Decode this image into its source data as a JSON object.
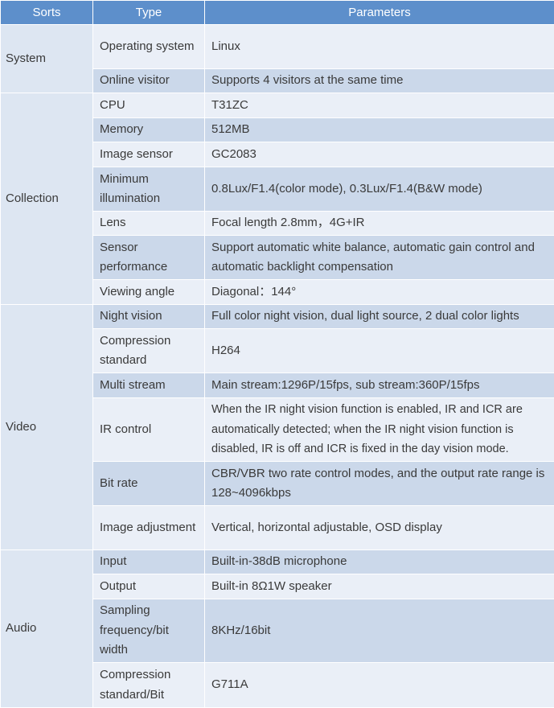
{
  "header": {
    "sorts": "Sorts",
    "type": "Type",
    "parameters": "Parameters"
  },
  "groups": [
    {
      "sort": "System",
      "rows": [
        {
          "type": "Operating system",
          "value": "Linux"
        },
        {
          "type": "Online visitor",
          "value": "Supports 4 visitors at the same time"
        }
      ]
    },
    {
      "sort": "Collection",
      "rows": [
        {
          "type": "CPU",
          "value": "T31ZC"
        },
        {
          "type": "Memory",
          "value": "512MB"
        },
        {
          "type": "Image sensor",
          "value": "GC2083"
        },
        {
          "type": "Minimum illumination",
          "value": "0.8Lux/F1.4(color mode), 0.3Lux/F1.4(B&W mode)"
        },
        {
          "type": "Lens",
          "value": "Focal length 2.8mm，4G+IR"
        },
        {
          "type": "Sensor performance",
          "value": "Support automatic white balance, automatic gain control and automatic backlight compensation"
        },
        {
          "type": "Viewing angle",
          "value": "Diagonal：144°"
        }
      ]
    },
    {
      "sort": "Video",
      "rows": [
        {
          "type": "Night vision",
          "value": "Full color night vision, dual light source, 2 dual color lights"
        },
        {
          "type": "Compression standard",
          "value": "H264"
        },
        {
          "type": "Multi stream",
          "value": "Main stream:1296P/15fps, sub stream:360P/15fps"
        },
        {
          "type": "IR control",
          "value": "When the IR night vision function is enabled, IR and ICR are automatically detected; when the IR night vision function is disabled, IR is off and ICR is fixed in the day vision mode."
        },
        {
          "type": "Bit rate",
          "value": "CBR/VBR two rate control modes, and the output rate range is 128~4096kbps"
        },
        {
          "type": "Image adjustment",
          "value": "Vertical, horizontal adjustable, OSD display"
        }
      ]
    },
    {
      "sort": "Audio",
      "rows": [
        {
          "type": "Input",
          "value": "Built-in-38dB microphone"
        },
        {
          "type": "Output",
          "value": "Built-in 8Ω1W speaker"
        },
        {
          "type": "Sampling frequency/bit width",
          "value": "8KHz/16bit"
        },
        {
          "type": "Compression standard/Bit",
          "value": "G711A"
        }
      ]
    }
  ]
}
